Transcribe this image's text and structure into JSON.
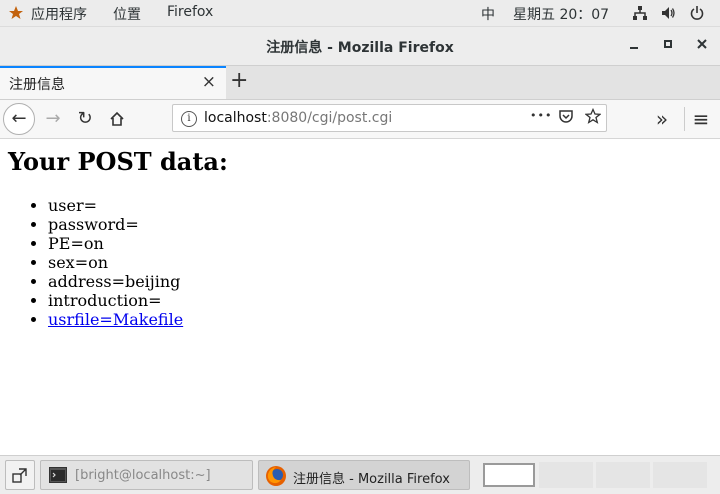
{
  "topbar": {
    "apps_label": "应用程序",
    "places_label": "位置",
    "active_app": "Firefox",
    "input_method": "中",
    "clock": "星期五 20：07"
  },
  "window": {
    "title": "注册信息 - Mozilla Firefox"
  },
  "tab": {
    "title": "注册信息",
    "close_glyph": "×",
    "new_tab_glyph": "+"
  },
  "navbar": {
    "url_host": "localhost",
    "url_rest": ":8080/cgi/post.cgi",
    "back_glyph": "←",
    "forward_glyph": "→",
    "reload_glyph": "↻",
    "more_glyph": "•••",
    "overflow_glyph": "»",
    "menu_glyph": "≡"
  },
  "page": {
    "heading": "Your POST data:",
    "items": [
      "user=",
      "password=",
      "PE=on",
      "sex=on",
      "address=beijing",
      "introduction="
    ],
    "link_item": "usrfile=Makefile"
  },
  "taskbar": {
    "terminal_label": "[bright@localhost:~]",
    "firefox_label": "注册信息 - Mozilla Firefox"
  }
}
